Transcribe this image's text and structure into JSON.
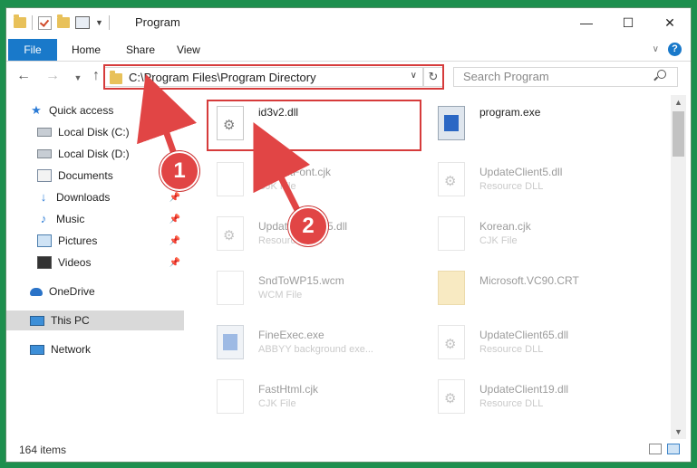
{
  "window": {
    "title": "Program",
    "controls": {
      "minimize": "—",
      "maximize": "☐",
      "close": "✕"
    }
  },
  "ribbon": {
    "tabs": [
      "File",
      "Home",
      "Share",
      "View"
    ],
    "help": "?"
  },
  "nav": {
    "address": "C:\\Program Files\\Program Directory",
    "search_placeholder": "Search Program"
  },
  "sidebar": {
    "items": [
      {
        "label": "Quick access",
        "icon": "star-icon"
      },
      {
        "label": "Local Disk (C:)",
        "icon": "disk-icon"
      },
      {
        "label": "Local Disk (D:)",
        "icon": "disk-icon"
      },
      {
        "label": "Documents",
        "icon": "documents-icon"
      },
      {
        "label": "Downloads",
        "icon": "download-icon",
        "pinned": true
      },
      {
        "label": "Music",
        "icon": "music-icon",
        "pinned": true
      },
      {
        "label": "Pictures",
        "icon": "pictures-icon",
        "pinned": true
      },
      {
        "label": "Videos",
        "icon": "videos-icon",
        "pinned": true
      },
      {
        "label": "OneDrive",
        "icon": "onedrive-icon"
      },
      {
        "label": "This PC",
        "icon": "computer-icon",
        "selected": true
      },
      {
        "label": "Network",
        "icon": "network-icon"
      }
    ]
  },
  "files": [
    {
      "name": "id3v2.dll",
      "type": "",
      "icon": "gear-file-icon"
    },
    {
      "name": "program.exe",
      "type": "",
      "icon": "app-file-icon"
    },
    {
      "name": "DefaultFont.cjk",
      "type": "CJK File",
      "icon": "blank-file-icon"
    },
    {
      "name": "UpdateClient5.dll",
      "type": "Resource DLL",
      "icon": "gear-file-icon"
    },
    {
      "name": "UpdateClient65.dll",
      "type": "Resource DLL",
      "icon": "gear-file-icon"
    },
    {
      "name": "Korean.cjk",
      "type": "CJK File",
      "icon": "blank-file-icon"
    },
    {
      "name": "SndToWP15.wcm",
      "type": "WCM File",
      "icon": "blank-file-icon"
    },
    {
      "name": "Microsoft.VC90.CRT",
      "type": "",
      "icon": "folder-icon"
    },
    {
      "name": "FineExec.exe",
      "type": "ABBYY background exe...",
      "icon": "app-file-icon"
    },
    {
      "name": "UpdateClient65.dll",
      "type": "Resource DLL",
      "icon": "gear-file-icon"
    },
    {
      "name": "FastHtml.cjk",
      "type": "CJK File",
      "icon": "blank-file-icon"
    },
    {
      "name": "UpdateClient19.dll",
      "type": "Resource DLL",
      "icon": "gear-file-icon"
    }
  ],
  "status": {
    "count": "164 items"
  },
  "annotations": {
    "step1": "1",
    "step2": "2",
    "color": "#d63b3b"
  }
}
